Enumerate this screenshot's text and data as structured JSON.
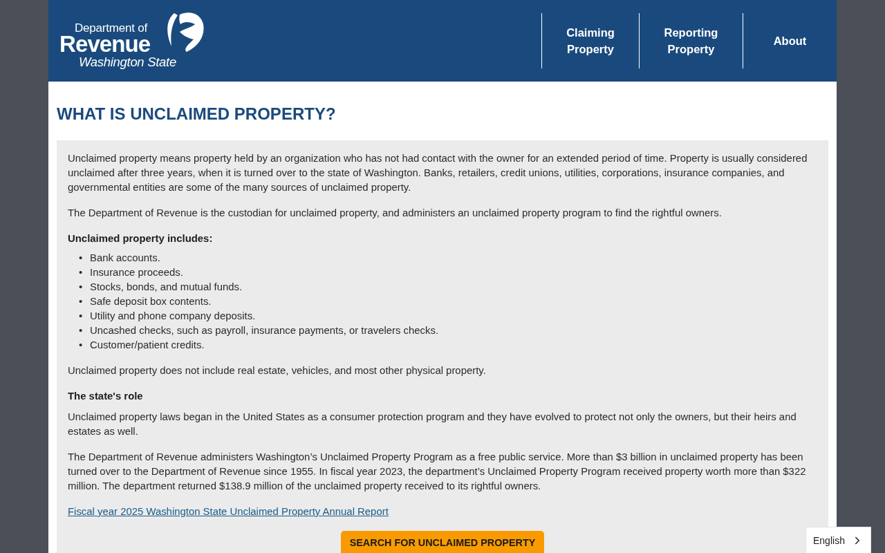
{
  "header": {
    "logo": {
      "line_1": "Department of",
      "line_2": "Revenue",
      "line_3": "Washington State"
    },
    "nav": [
      {
        "label": "Claiming Property"
      },
      {
        "label": "Reporting Property"
      },
      {
        "label": "About"
      }
    ]
  },
  "page_title": "WHAT IS UNCLAIMED PROPERTY?",
  "content": [
    {
      "kind": "paragraph",
      "text": "Unclaimed property means property held by an organization who has not had contact with the owner for an extended period of time. Property is usually considered unclaimed after three years, when it is turned over to the state of Washington. Banks, retailers, credit unions, utilities, corporations, insurance companies, and governmental entities are some of the many sources of unclaimed property."
    },
    {
      "kind": "paragraph",
      "text": "The Department of Revenue is the custodian for unclaimed property, and administers an unclaimed property program to find the rightful owners."
    },
    {
      "kind": "subheading",
      "text": "Unclaimed property includes:"
    },
    {
      "kind": "list",
      "items": [
        {
          "bullet": "•",
          "text": "Bank accounts."
        },
        {
          "bullet": "•",
          "text": "Insurance proceeds."
        },
        {
          "bullet": "•",
          "text": "Stocks, bonds, and mutual funds."
        },
        {
          "bullet": "•",
          "text": "Safe deposit box contents."
        },
        {
          "bullet": "•",
          "text": "Utility and phone company deposits."
        },
        {
          "bullet": "•",
          "text": "Uncashed checks, such as payroll, insurance payments, or travelers checks."
        },
        {
          "bullet": "•",
          "text": "Customer/patient credits."
        }
      ]
    },
    {
      "kind": "paragraph",
      "text": "Unclaimed property does not include real estate, vehicles, and most other physical property."
    },
    {
      "kind": "subheading",
      "text": "The state's role"
    },
    {
      "kind": "paragraph",
      "text": "Unclaimed property laws began in the United States as a consumer protection program and they have evolved to protect not only the owners, but their heirs and estates as well."
    },
    {
      "kind": "paragraph",
      "text": "The Department of Revenue administers Washington’s Unclaimed Property Program as a free public service. More than $3 billion in unclaimed property has been turned over to the Department of Revenue since 1955. In fiscal year 2023, the department’s Unclaimed Property Program received property worth more than $322 million. The department returned $138.9 million of the unclaimed property received to its rightful owners."
    },
    {
      "kind": "link",
      "text": "Fiscal year 2025 Washington State Unclaimed Property Annual Report"
    },
    {
      "kind": "button",
      "text": "SEARCH FOR UNCLAIMED PROPERTY"
    }
  ],
  "language_selector": {
    "label": "English"
  }
}
